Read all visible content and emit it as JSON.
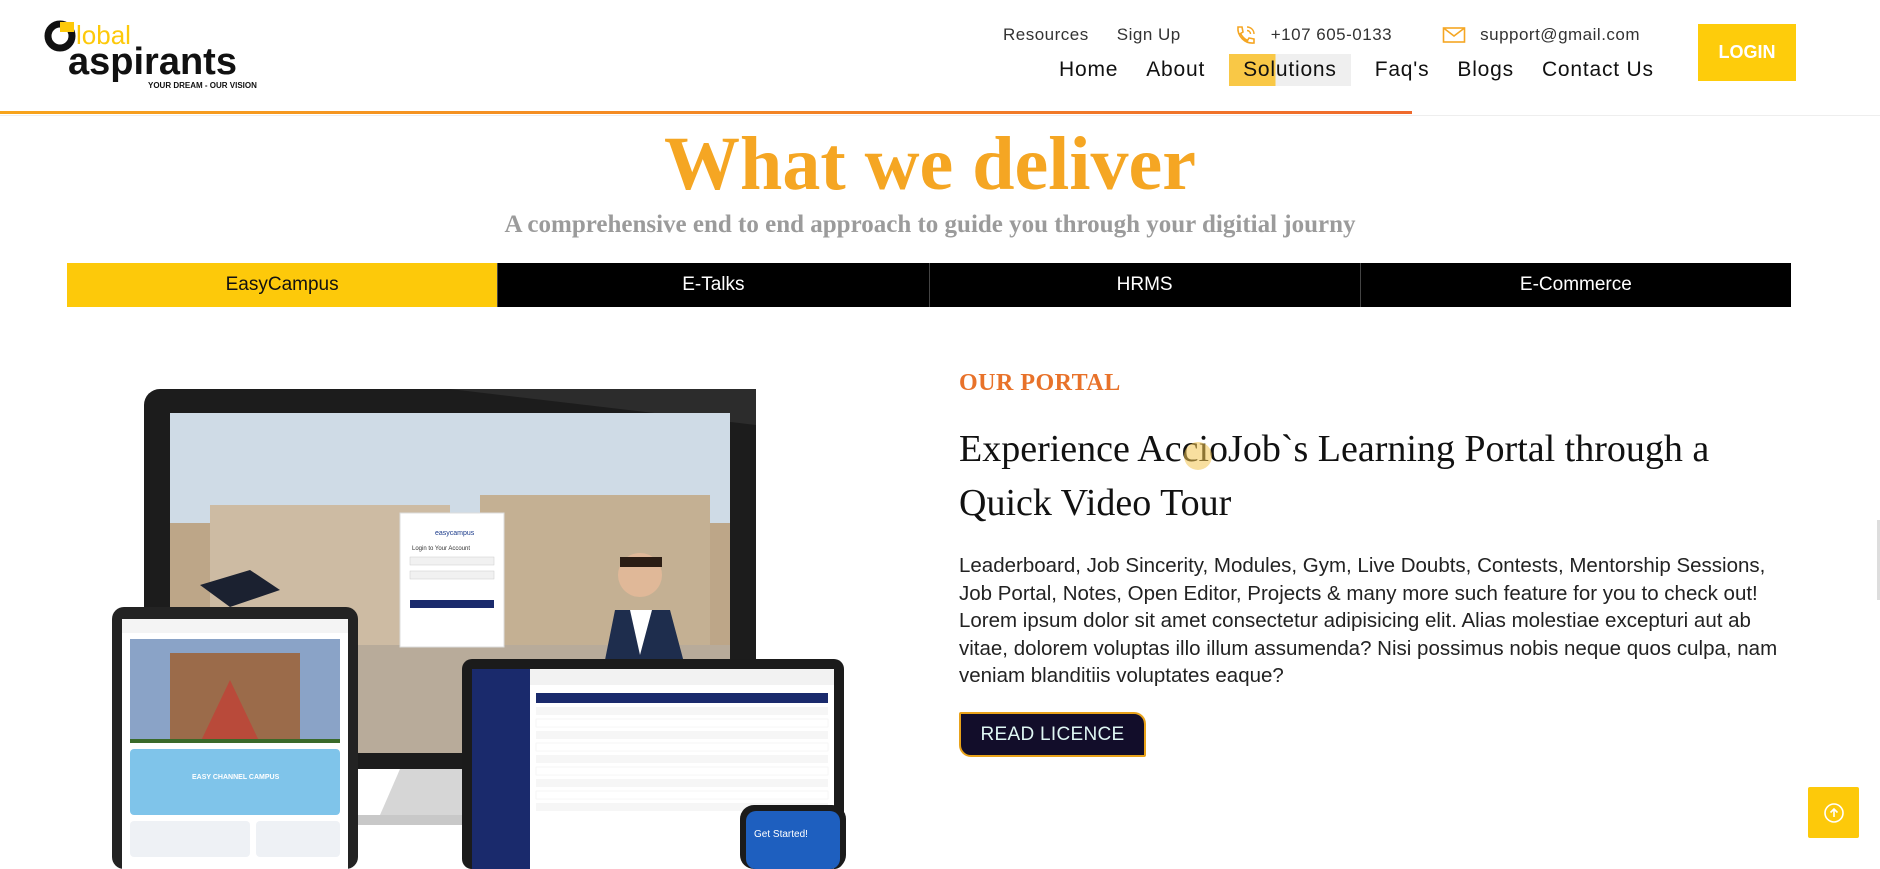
{
  "brand": {
    "logo_word_top": "lobal",
    "logo_word_main": "aspirants",
    "logo_tagline": "YOUR DREAM - OUR VISION"
  },
  "topbar": {
    "resources": "Resources",
    "signup": "Sign Up",
    "phone": "+107 605-0133",
    "email": "support@gmail.com"
  },
  "nav": {
    "items": [
      "Home",
      "About",
      "Solutions",
      "Faq's",
      "Blogs",
      "Contact Us"
    ],
    "active": "Solutions"
  },
  "login_label": "LOGIN",
  "section": {
    "title": "What we deliver",
    "subtitle": "A comprehensive end to end approach to guide you through your digitial journy"
  },
  "tabs": {
    "items": [
      "EasyCampus",
      "E-Talks",
      "HRMS",
      "E-Commerce"
    ],
    "active": "EasyCampus"
  },
  "devices": {
    "login_title": "Login to Your Account",
    "login_brand": "easycampus",
    "get_started": "Get Started!",
    "campus_banner": "EASY CHANNEL CAMPUS"
  },
  "content": {
    "eyebrow": "OUR PORTAL",
    "headline": "Experience AccioJob`s Learning Portal through a Quick Video Tour",
    "body": "Leaderboard, Job Sincerity, Modules, Gym, Live Doubts, Contests, Mentorship Sessions, Job Portal, Notes, Open Editor, Projects & many more such feature for you to check out! Lorem ipsum dolor sit amet consectetur adipisicing elit. Alias molestiae excepturi aut ab vitae, dolorem voluptas illo illum assumenda? Nisi possimus nobis neque quos culpa, nam veniam blanditiis voluptates eaque?",
    "cta": "READ LICENCE"
  },
  "colors": {
    "accent_yellow": "#fdc90a",
    "title_orange": "#f5a623",
    "eyebrow_orange": "#e8722a",
    "cta_bg": "#120d2a"
  },
  "icons": {
    "phone": "phone-icon",
    "mail": "mail-icon",
    "back_to_top": "arrow-up-circle-icon"
  }
}
